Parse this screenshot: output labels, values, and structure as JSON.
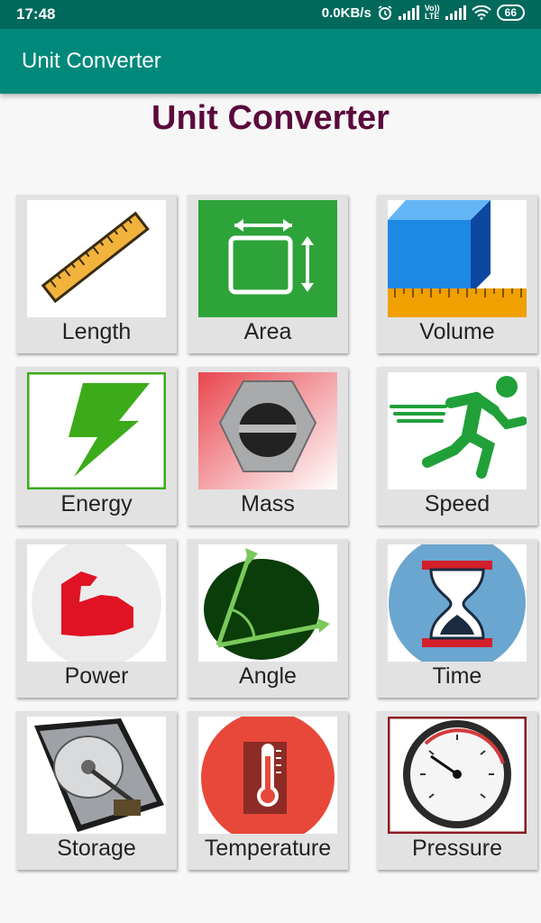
{
  "status": {
    "time": "17:48",
    "speed": "0.0KB/s",
    "lte_top": "Vo))",
    "lte_bottom": "LTE",
    "battery": "66"
  },
  "appbar": {
    "title": "Unit Converter"
  },
  "heading": "Unit Converter",
  "tiles": [
    {
      "label": "Length",
      "icon": "ruler-icon"
    },
    {
      "label": "Area",
      "icon": "area-icon"
    },
    {
      "label": "Volume",
      "icon": "cube-icon"
    },
    {
      "label": "Energy",
      "icon": "lightning-icon"
    },
    {
      "label": "Mass",
      "icon": "weight-icon"
    },
    {
      "label": "Speed",
      "icon": "running-man-icon"
    },
    {
      "label": "Power",
      "icon": "muscle-arm-icon"
    },
    {
      "label": "Angle",
      "icon": "angle-icon"
    },
    {
      "label": "Time",
      "icon": "hourglass-icon"
    },
    {
      "label": "Storage",
      "icon": "hard-drive-icon"
    },
    {
      "label": "Temperature",
      "icon": "thermometer-icon"
    },
    {
      "label": "Pressure",
      "icon": "pressure-gauge-icon"
    }
  ],
  "colors": {
    "status_bar": "#00695c",
    "app_bar": "#00897b",
    "heading": "#5b0a3c"
  }
}
